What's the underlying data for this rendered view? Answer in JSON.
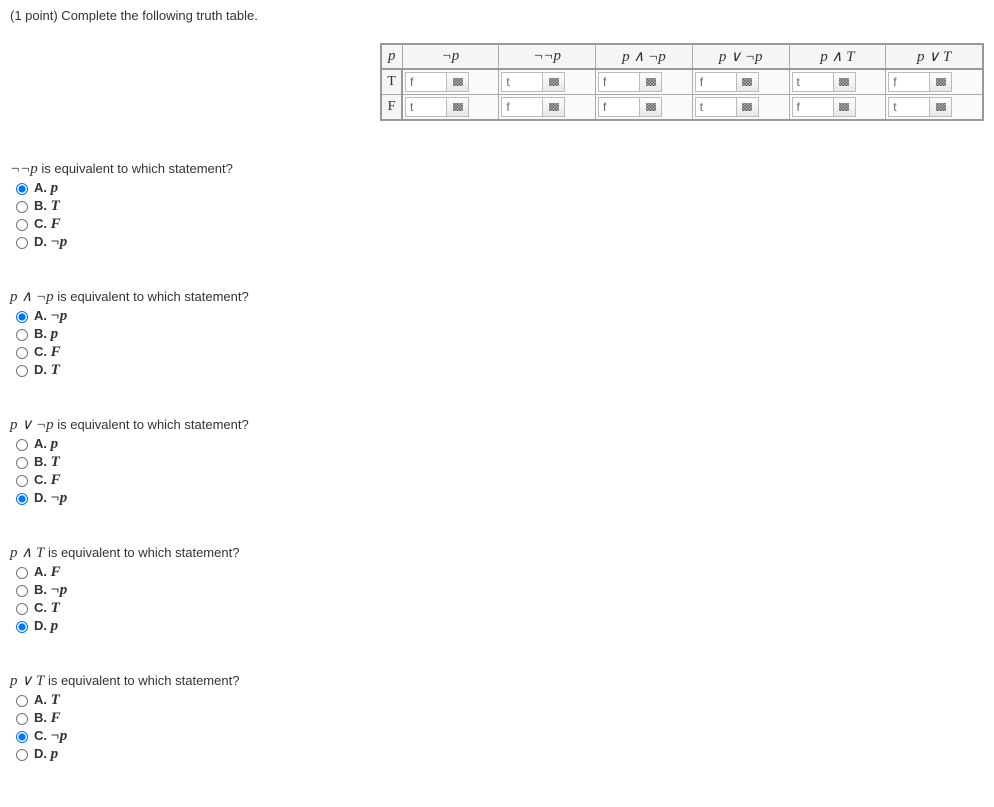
{
  "prompt": "(1 point) Complete the following truth table.",
  "table": {
    "headers": [
      "p",
      "¬p",
      "¬¬p",
      "p ∧ ¬p",
      "p ∨ ¬p",
      "p ∧ T",
      "p ∨ T"
    ],
    "rows": [
      {
        "p": "T",
        "cells": [
          "f",
          "t",
          "f",
          "f",
          "t",
          "f"
        ]
      },
      {
        "p": "F",
        "cells": [
          "t",
          "f",
          "f",
          "t",
          "f",
          "t"
        ]
      }
    ]
  },
  "questions": [
    {
      "expr": "¬¬p",
      "tail": " is equivalent to which statement?",
      "selected": 0,
      "options": [
        {
          "letter": "A.",
          "val": "p"
        },
        {
          "letter": "B.",
          "val": "T"
        },
        {
          "letter": "C.",
          "val": "F"
        },
        {
          "letter": "D.",
          "val": "¬p"
        }
      ]
    },
    {
      "expr": "p ∧ ¬p",
      "tail": " is equivalent to which statement?",
      "selected": 0,
      "options": [
        {
          "letter": "A.",
          "val": "¬p"
        },
        {
          "letter": "B.",
          "val": "p"
        },
        {
          "letter": "C.",
          "val": "F"
        },
        {
          "letter": "D.",
          "val": "T"
        }
      ]
    },
    {
      "expr": "p ∨ ¬p",
      "tail": " is equivalent to which statement?",
      "selected": 3,
      "options": [
        {
          "letter": "A.",
          "val": "p"
        },
        {
          "letter": "B.",
          "val": "T"
        },
        {
          "letter": "C.",
          "val": "F"
        },
        {
          "letter": "D.",
          "val": "¬p"
        }
      ]
    },
    {
      "expr": "p ∧ T",
      "tail": " is equivalent to which statement?",
      "selected": 3,
      "options": [
        {
          "letter": "A.",
          "val": "F"
        },
        {
          "letter": "B.",
          "val": "¬p"
        },
        {
          "letter": "C.",
          "val": "T"
        },
        {
          "letter": "D.",
          "val": "p"
        }
      ]
    },
    {
      "expr": "p ∨ T",
      "tail": " is equivalent to which statement?",
      "selected": 2,
      "options": [
        {
          "letter": "A.",
          "val": "T"
        },
        {
          "letter": "B.",
          "val": "F"
        },
        {
          "letter": "C.",
          "val": "¬p"
        },
        {
          "letter": "D.",
          "val": "p"
        }
      ]
    }
  ]
}
